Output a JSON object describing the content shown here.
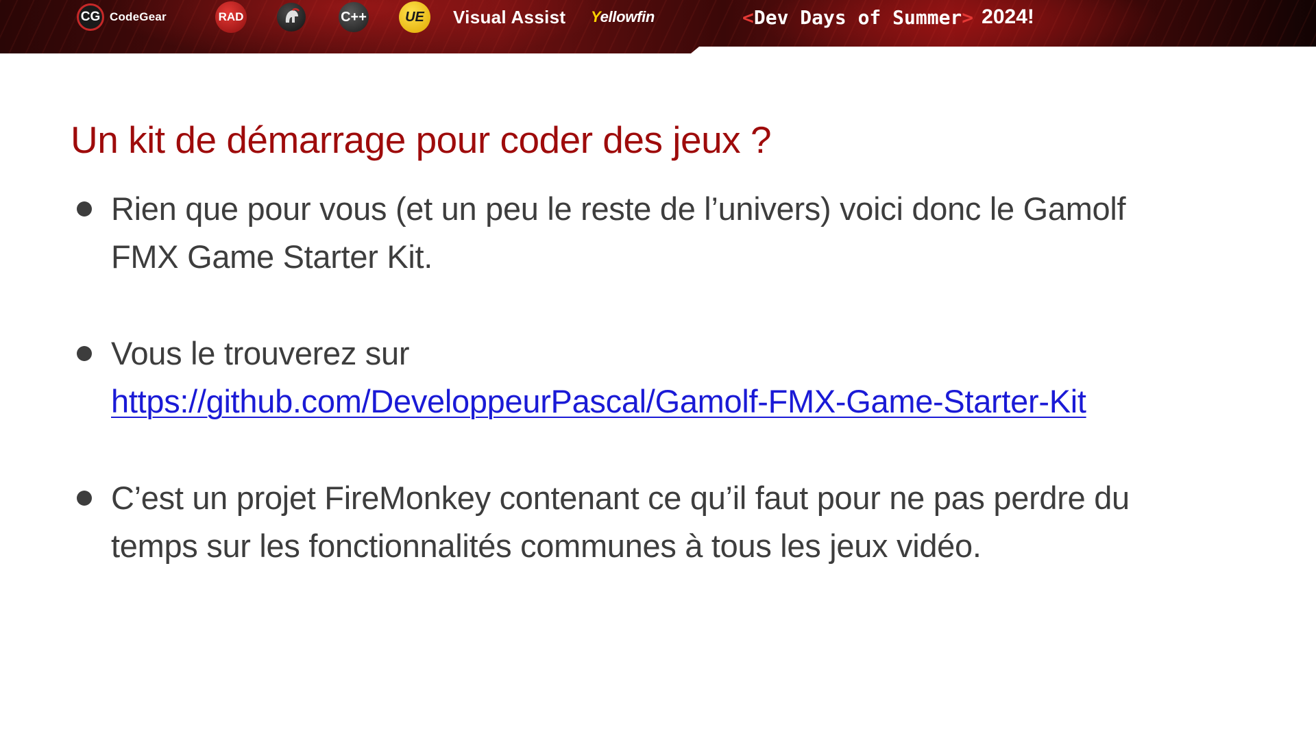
{
  "banner": {
    "codegear_badge": "CG",
    "codegear_label": "CodeGear",
    "rad_badge": "RAD",
    "cpp_badge": "C++",
    "ue_badge": "UE",
    "visual_assist_label": "Visual Assist",
    "yellowfin_first": "Y",
    "yellowfin_rest": "ellowfin",
    "event_open_bracket": "<",
    "event_name": "Dev Days of Summer",
    "event_close_bracket": ">",
    "event_year": "2024!",
    "accent_color": "#c62828"
  },
  "slide": {
    "title": "Un kit de démarrage pour coder des jeux ?",
    "title_color": "#9e0b0b",
    "bullets": [
      {
        "line1": "Rien que pour vous (et un peu le reste de l’univers) voici donc le Gamolf",
        "line2": "FMX Game Starter Kit."
      },
      {
        "line1": "Vous le trouverez sur",
        "link": "https://github.com/DeveloppeurPascal/Gamolf-FMX-Game-Starter-Kit"
      },
      {
        "line1": "C’est un projet FireMonkey contenant ce qu’il faut pour ne pas perdre du",
        "line2": "temps sur les fonctionnalités communes à tous les jeux vidéo."
      }
    ],
    "link_color": "#1a1ad6"
  }
}
